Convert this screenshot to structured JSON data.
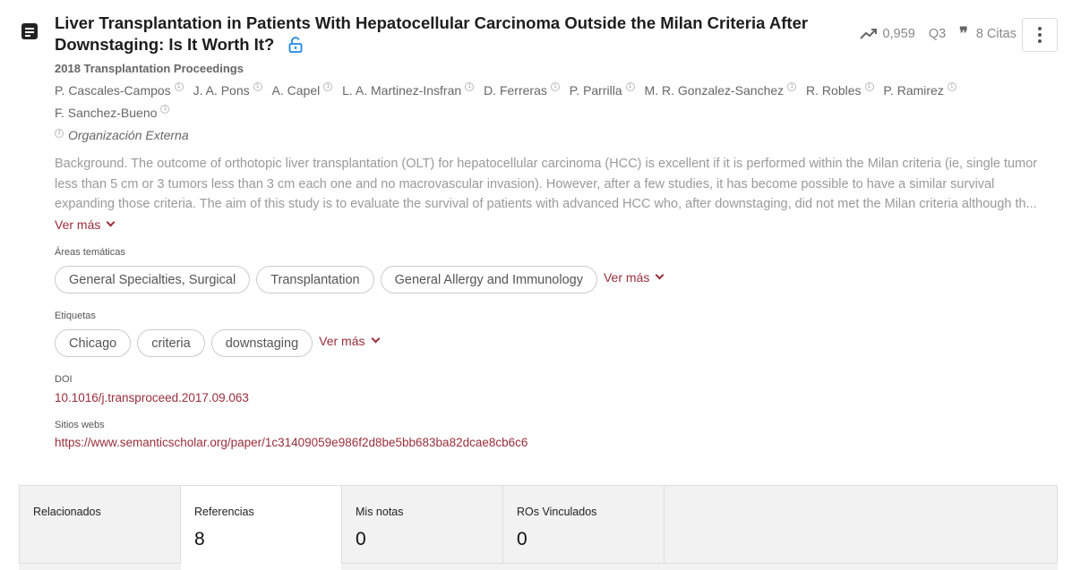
{
  "title": "Liver Transplantation in Patients With Hepatocellular Carcinoma Outside the Milan Criteria After Downstaging: Is It Worth It?",
  "metrics": {
    "score": "0,959",
    "quartile": "Q3",
    "citations": "8 Citas"
  },
  "journal": "2018 Transplantation Proceedings",
  "authors": [
    "P. Cascales-Campos",
    "J. A. Pons",
    "A. Capel",
    "L. A. Martinez-Insfran",
    "D. Ferreras",
    "P. Parrilla",
    "M. R. Gonzalez-Sanchez",
    "R. Robles",
    "P. Ramirez",
    "F. Sanchez-Bueno"
  ],
  "author_marker": "1",
  "external_org": "Organización Externa",
  "abstract": {
    "lines": [
      "Background. The outcome of orthotopic liver transplantation (OLT) for hepatocellular carcinoma (HCC) is excellent if it is performed within the Milan criteria (ie, single tumor",
      "less than 5 cm or 3 tumors less than 3 cm each one and no macrovascular invasion). However, after a few studies, it has become possible to have a similar survival",
      "expanding those criteria. The aim of this study is to evaluate the survival of patients with advanced HCC who, after downstaging, did not met the Milan criteria although th..."
    ],
    "see_more": "Ver más"
  },
  "areas": {
    "label": "Áreas temáticas",
    "items": [
      "General Specialties, Surgical",
      "Transplantation",
      "General Allergy and Immunology"
    ],
    "see_more": "Ver más"
  },
  "tags": {
    "label": "Etiquetas",
    "items": [
      "Chicago",
      "criteria",
      "downstaging"
    ],
    "see_more": "Ver más"
  },
  "doi": {
    "label": "DOI",
    "value": "10.1016/j.transproceed.2017.09.063"
  },
  "websites": {
    "label": "Sitios webs",
    "value": "https://www.semanticscholar.org/paper/1c31409059e986f2d8be5bb683ba82dcae8cb6c6"
  },
  "tabs": [
    {
      "label": "Relacionados",
      "count": ""
    },
    {
      "label": "Referencias",
      "count": "8",
      "active": true
    },
    {
      "label": "Mis notas",
      "count": "0"
    },
    {
      "label": "ROs Vinculados",
      "count": "0"
    }
  ],
  "colors": {
    "accent": "#9a2e3a",
    "lock": "#1e88e5"
  }
}
